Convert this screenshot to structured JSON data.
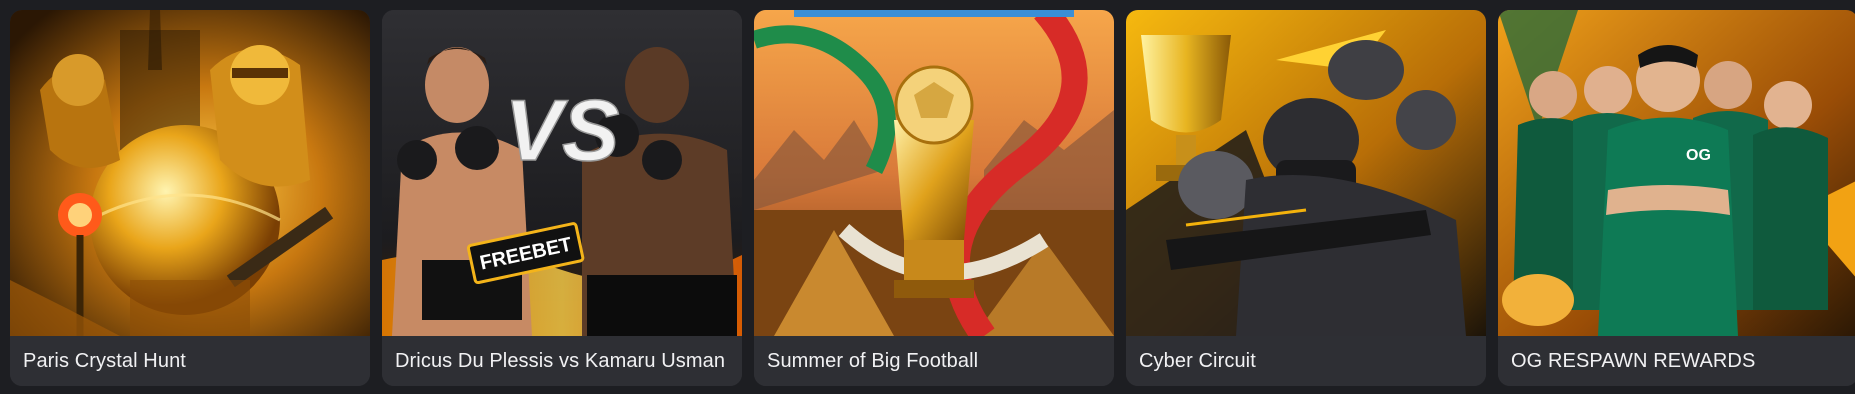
{
  "promotions": [
    {
      "title": "Paris Crystal Hunt",
      "artwork": "golden-knight-warriors-artwork",
      "accent": "#f2a413"
    },
    {
      "title": "Dricus Du Plessis vs Kamaru Usman",
      "artwork": "ufc-fighters-versus-artwork",
      "accent": "#e8a317",
      "badge": "FREEBET",
      "vs_text": "VS"
    },
    {
      "title": "Summer of Big Football",
      "artwork": "golden-trophy-flags-artwork",
      "accent": "#e0341f"
    },
    {
      "title": "Cyber Circuit",
      "artwork": "esports-soldier-trophy-artwork",
      "accent": "#f3b20c"
    },
    {
      "title": "OG RESPAWN REWARDS",
      "artwork": "og-esports-team-artwork",
      "accent": "#1aa66c"
    }
  ]
}
